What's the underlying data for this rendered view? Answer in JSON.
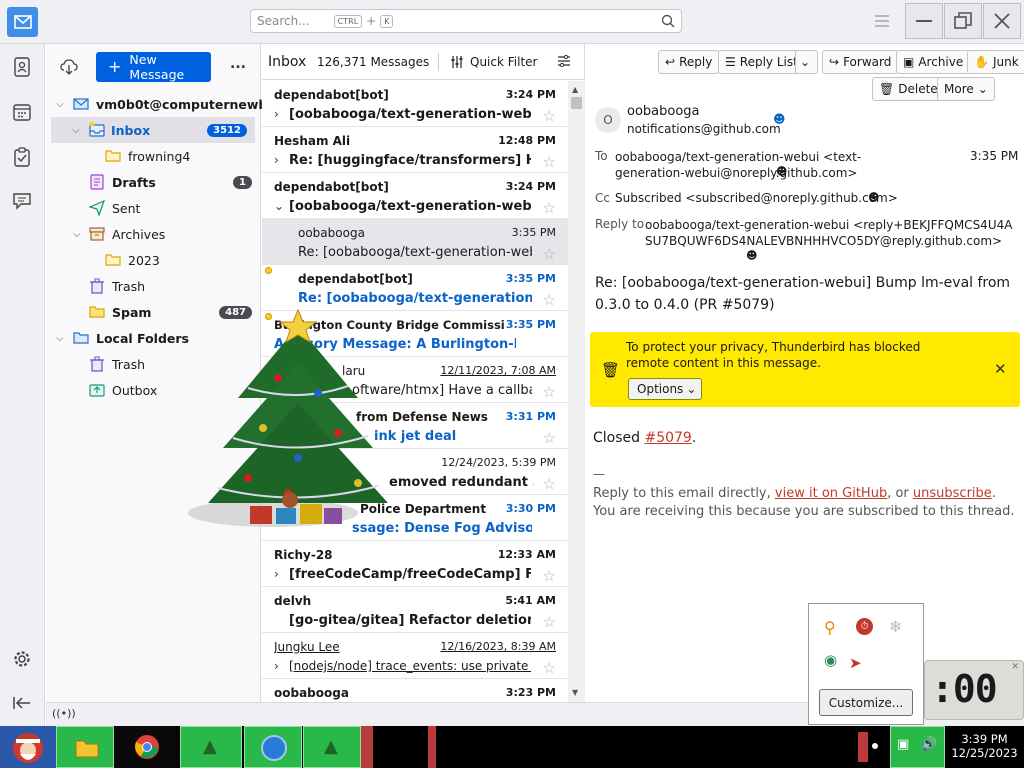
{
  "search": {
    "placeholder": "Search...",
    "kbd_ctrl": "CTRL",
    "plus": "+",
    "kbd_k": "K"
  },
  "folder_pane": {
    "new_message": "New Message",
    "more": "...",
    "account": "vm0b0t@computernewb...",
    "folders": [
      {
        "label": "Inbox",
        "count": "3512"
      },
      {
        "label": "frowning4"
      },
      {
        "label": "Drafts",
        "count": "1"
      },
      {
        "label": "Sent"
      },
      {
        "label": "Archives"
      },
      {
        "label": "2023"
      },
      {
        "label": "Trash"
      },
      {
        "label": "Spam",
        "count": "487"
      },
      {
        "label": "Local Folders"
      },
      {
        "label": "Trash"
      },
      {
        "label": "Outbox"
      }
    ]
  },
  "list": {
    "folder": "Inbox",
    "count": "126,371 Messages",
    "quick_filter": "Quick Filter",
    "messages": [
      {
        "from": "dependabot[bot]",
        "date": "3:24 PM",
        "subject": "[oobabooga/text-generation-webui] ..."
      },
      {
        "from": "Hesham Ali",
        "date": "12:48 PM",
        "subject": "Re: [huggingface/transformers] High..."
      },
      {
        "from": "dependabot[bot]",
        "date": "3:24 PM",
        "subject": "[oobabooga/text-generation-webui] ..."
      },
      {
        "from": "oobabooga",
        "date": "3:35 PM",
        "subject": "Re: [oobabooga/text-generation-webu..."
      },
      {
        "from": "dependabot[bot]",
        "date": "3:35 PM",
        "subject": "Re: [oobabooga/text-generation-we..."
      },
      {
        "from": "Burlington County Bridge Commission P...",
        "date": "3:35 PM",
        "subject": "Advisory Message: A Burlington-Bristol..."
      },
      {
        "from": "laru",
        "date": "12/11/2023, 7:08 AM",
        "subject": "oftware/htmx] Have a callback f..."
      },
      {
        "from": "from Defense News",
        "date": "3:31 PM",
        "subject": "ink jet deal"
      },
      {
        "from": "",
        "date": "12/24/2023, 5:39 PM",
        "subject": "emoved redundant ..."
      },
      {
        "from": "Police Department",
        "date": "3:30 PM",
        "subject": "ssage: Dense Fog Advisory..."
      },
      {
        "from": "Richy-28",
        "date": "12:33 AM",
        "subject": "[freeCodeCamp/freeCodeCamp] False..."
      },
      {
        "from": "delvh",
        "date": "5:41 AM",
        "subject": "[go-gitea/gitea] Refactor deletion (P..."
      },
      {
        "from": "Jungku Lee",
        "date": "12/16/2023, 8:39 AM",
        "subject": "[nodejs/node] trace_events: use private ..."
      },
      {
        "from": "oobabooga",
        "date": "3:23 PM",
        "subject": ""
      }
    ]
  },
  "message": {
    "buttons": {
      "reply": "Reply",
      "reply_list": "Reply List",
      "forward": "Forward",
      "archive": "Archive",
      "junk": "Junk",
      "delete": "Delete",
      "more": "More"
    },
    "avatar_letter": "O",
    "sender_name": "oobabooga",
    "sender_email": "notifications@github.com",
    "to_label": "To",
    "to_value": "oobabooga/text-generation-webui <text-generation-webui@noreply.github.com>",
    "time": "3:35 PM",
    "cc_label": "Cc",
    "cc_value": "Subscribed <subscribed@noreply.github.com>",
    "replyto_label": "Reply to",
    "replyto_value": "oobabooga/text-generation-webui <reply+BEKJFFQMCS4U4ASU7BQUWF6DS4NALEVBNHHHVCO5DY@reply.github.com>",
    "subject": "Re: [oobabooga/text-generation-webui] Bump lm-eval from 0.3.0 to 0.4.0 (PR #5079)",
    "notice": "To protect your privacy, Thunderbird has blocked remote content in this message.",
    "options": "Options",
    "body_closed": "Closed ",
    "body_link": "#5079",
    "body_period": ".",
    "sig_dash": "—",
    "footer1_a": "Reply to this email directly, ",
    "footer1_link1": "view it on GitHub",
    "footer1_b": ", or ",
    "footer1_link2": "unsubscribe",
    "footer1_c": ".",
    "footer2": "You are receiving this because you are subscribed to this thread."
  },
  "tray": {
    "customize": "Customize...",
    "time": "3:39 PM",
    "date": "12/25/2023",
    "clock_widget": ":00"
  },
  "colors": {
    "accent": "#0061e0",
    "notice_bg": "#ffe900",
    "link": "#c0392b",
    "unread_blue": "#0b63c8"
  }
}
